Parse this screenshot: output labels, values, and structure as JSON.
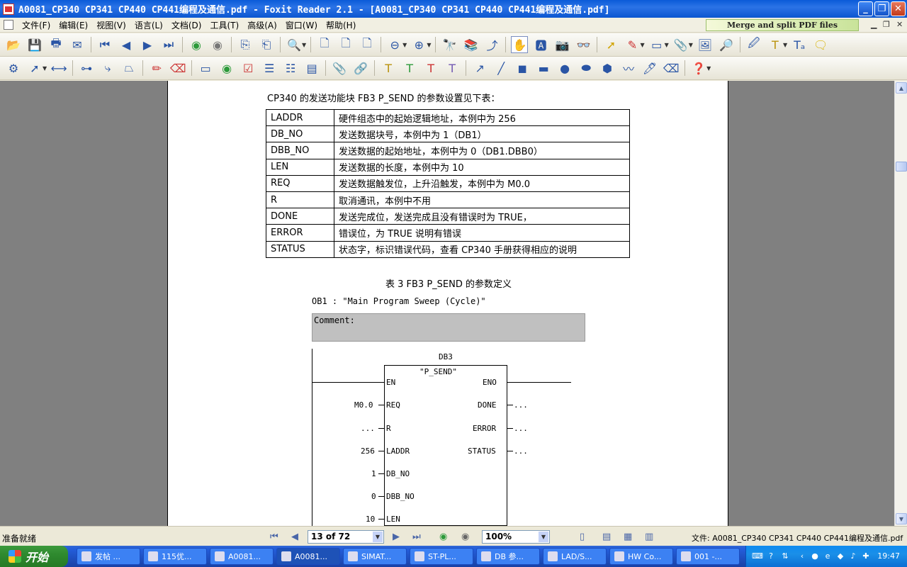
{
  "window": {
    "title": "A0081_CP340 CP341 CP440 CP441编程及通信.pdf - Foxit Reader 2.1 - [A0081_CP340 CP341 CP440 CP441编程及通信.pdf]",
    "min": "_",
    "max": "❐",
    "close": "✕"
  },
  "menu": {
    "items": [
      "文件(F)",
      "编辑(E)",
      "视图(V)",
      "语言(L)",
      "文档(D)",
      "工具(T)",
      "高级(A)",
      "窗口(W)",
      "帮助(H)"
    ],
    "banner": "Merge and split PDF files"
  },
  "document": {
    "intro": "CP340 的发送功能块 FB3 P_SEND 的参数设置见下表：",
    "table": [
      [
        "LADDR",
        "硬件组态中的起始逻辑地址，本例中为 256"
      ],
      [
        "DB_NO",
        "发送数据块号，本例中为 1（DB1）"
      ],
      [
        "DBB_NO",
        "发送数据的起始地址，本例中为 0（DB1.DBB0）"
      ],
      [
        "LEN",
        "发送数据的长度，本例中为 10"
      ],
      [
        "REQ",
        "发送数据触发位，上升沿触发，本例中为 M0.0"
      ],
      [
        "R",
        "取消通讯，本例中不用"
      ],
      [
        "DONE",
        "发送完成位，发送完成且没有错误时为 TRUE，"
      ],
      [
        "ERROR",
        "错误位，为 TRUE 说明有错误"
      ],
      [
        "STATUS",
        "状态字，标识错误代码，查看 CP340 手册获得相应的说明"
      ]
    ],
    "caption": "表 3 FB3 P_SEND 的参数定义",
    "ob1": "OB1 :  \"Main Program Sweep (Cycle)\"",
    "comment": "Comment:",
    "block_db": "DB3",
    "block_name": "\"P_SEND\"",
    "inputs": [
      {
        "pin": "EN",
        "value": ""
      },
      {
        "pin": "REQ",
        "value": "M0.0"
      },
      {
        "pin": "R",
        "value": "..."
      },
      {
        "pin": "LADDR",
        "value": "256"
      },
      {
        "pin": "DB_NO",
        "value": "1"
      },
      {
        "pin": "DBB_NO",
        "value": "0"
      },
      {
        "pin": "LEN",
        "value": "10"
      }
    ],
    "outputs": [
      {
        "pin": "ENO",
        "value": ""
      },
      {
        "pin": "DONE",
        "value": "..."
      },
      {
        "pin": "ERROR",
        "value": "..."
      },
      {
        "pin": "STATUS",
        "value": "..."
      }
    ]
  },
  "statusbar": {
    "status": "准备就绪",
    "page": "13 of 72",
    "zoom": "100%",
    "file": "文件: A0081_CP340 CP341 CP440 CP441编程及通信.pdf"
  },
  "taskbar": {
    "start": "开始",
    "tasks": [
      "发帖 ...",
      "115优...",
      "A0081...",
      "A0081...",
      "SIMAT...",
      "ST-PL...",
      "DB 参...",
      "LAD/S...",
      "HW Co...",
      "001 -..."
    ],
    "clock": "19:47"
  }
}
